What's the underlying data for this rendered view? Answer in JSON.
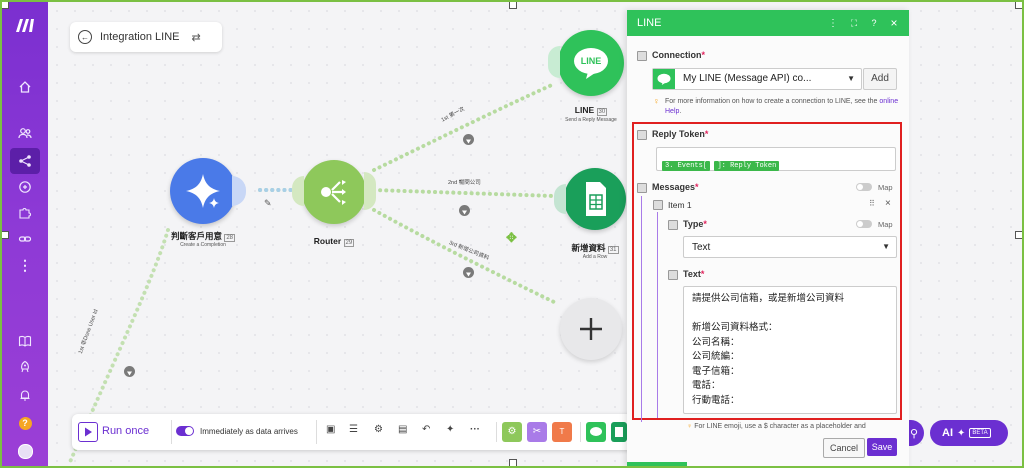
{
  "scenario": {
    "title": "Integration LINE"
  },
  "modules": {
    "ai": {
      "label": "判斷客戶用意",
      "badge": "28",
      "sub": "Create a Completion"
    },
    "router": {
      "label": "Router",
      "badge": "29"
    },
    "line": {
      "label": "LINE",
      "badge": "30",
      "sub": "Send a Reply Message"
    },
    "sheets": {
      "label": "新增資料",
      "badge": "31",
      "sub": "Add a Row"
    }
  },
  "paths": {
    "first": "1st  第一次",
    "second": "2nd  暢問公司",
    "third": "3rd  新增公司資料",
    "left": "1st  非Done User Id"
  },
  "bottombar": {
    "run_once": "Run once",
    "schedule": "Immediately as data arrives",
    "more": "···"
  },
  "ai_button": {
    "label": "AI",
    "beta": "BETA"
  },
  "panel": {
    "title": "LINE",
    "header_icons": {
      "menu": "⋮",
      "expand": "⛶",
      "help": "?",
      "close": "×"
    },
    "connection": {
      "label": "Connection",
      "value": "My LINE (Message API) co...",
      "add": "Add",
      "hint_prefix": "For more information on how to create a connection to LINE, see the ",
      "hint_link": "online Help",
      "hint_suffix": "."
    },
    "reply_token": {
      "label": "Reply Token",
      "pill1": "3. Events[",
      "pill2": "]: Reply Token"
    },
    "messages": {
      "label": "Messages",
      "map": "Map",
      "item": "Item 1",
      "type_label": "Type",
      "type_value": "Text",
      "text_label": "Text",
      "text_lines": [
        "請提供公司信箱，或是新增公司資料",
        "",
        "新增公司資料格式：",
        "公司名稱：",
        "公司統編：",
        "電子信箱：",
        "電話：",
        "行動電話："
      ]
    },
    "footer_hint": "For LINE emoji, use a $ character as a placeholder and",
    "cancel": "Cancel",
    "save": "Save"
  },
  "colors": {
    "sidebar": "#8e3ad6",
    "line_green": "#2fc25a",
    "ai_blue": "#4a7ae8",
    "router_green": "#8ec85b",
    "sheets_green": "#1a9f5a",
    "highlight_red": "#e02020",
    "accent_purple": "#6b2fd1"
  }
}
